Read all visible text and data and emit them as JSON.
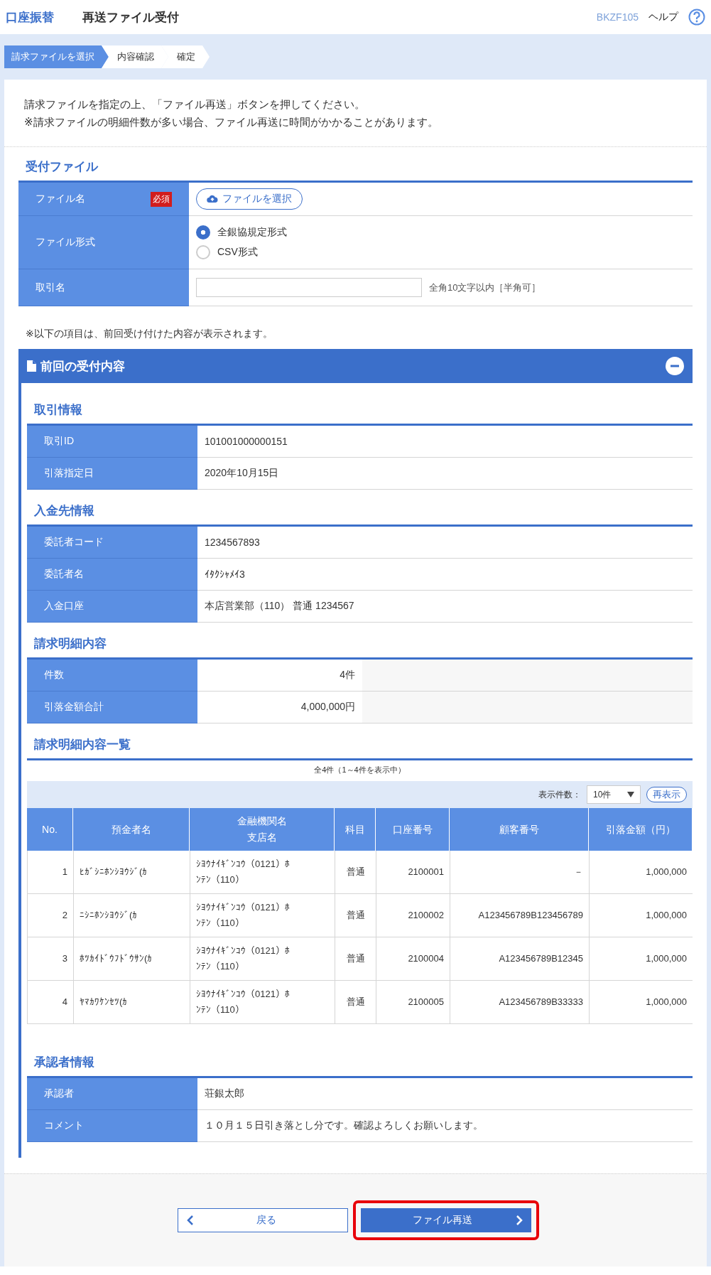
{
  "header": {
    "category": "口座振替",
    "title": "再送ファイル受付",
    "screen_id": "BKZF105",
    "help": "ヘルプ"
  },
  "steps": [
    {
      "label": "請求ファイルを選択",
      "selected": true
    },
    {
      "label": "内容確認",
      "selected": false
    },
    {
      "label": "確定",
      "selected": false
    }
  ],
  "intro": [
    "請求ファイルを指定の上、「ファイル再送」ボタンを押してください。",
    "※請求ファイルの明細件数が多い場合、ファイル再送に時間がかかることがあります。"
  ],
  "upload": {
    "heading": "受付ファイル",
    "rows": [
      {
        "kind": "file",
        "label": "ファイル名",
        "required": "必須",
        "button": "ファイルを選択"
      },
      {
        "kind": "radio",
        "label": "ファイル形式",
        "options": [
          {
            "label": "全銀協規定形式",
            "selected": true
          },
          {
            "label": "CSV形式",
            "selected": false
          }
        ]
      },
      {
        "kind": "text",
        "label": "取引名",
        "hint": "全角10文字以内［半角可］"
      }
    ]
  },
  "note": "※以下の項目は、前回受け付けた内容が表示されます。",
  "previous": {
    "title": "前回の受付内容",
    "expanded": true,
    "sections": [
      {
        "heading": "取引情報",
        "rows": [
          {
            "label": "取引ID",
            "value": "101001000000151"
          },
          {
            "label": "引落指定日",
            "value": "2020年10月15日"
          }
        ]
      },
      {
        "heading": "入金先情報",
        "rows": [
          {
            "label": "委託者コード",
            "value": "1234567893"
          },
          {
            "label": "委託者名",
            "value": "ｲﾀｸｼｬﾒｲ3"
          },
          {
            "label": "入金口座",
            "value": "本店営業部（110） 普通 1234567"
          }
        ]
      },
      {
        "heading": "請求明細内容",
        "narrow": true,
        "rows": [
          {
            "label": "件数",
            "value": "4件"
          },
          {
            "label": "引落金額合計",
            "value": "4,000,000円"
          }
        ]
      }
    ],
    "list": {
      "heading": "請求明細内容一覧",
      "summary": "全4件（1～4件を表示中）",
      "page_size_label": "表示件数：",
      "page_size": "10件",
      "refresh": "再表示",
      "columns": [
        "No.",
        "預金者名",
        "金融機関名支店名",
        "科目",
        "口座番号",
        "顧客番号",
        "引落金額（円）"
      ],
      "rows": [
        [
          "1",
          "ﾋｶﾞｼﾆﾎﾝｼﾖｳｼﾞ(ｶ",
          "ｼﾖｳﾅｲｷﾞﾝｺｳ（0121）ﾎﾝﾃﾝ（110）",
          "普通",
          "2100001",
          "－",
          "1,000,000"
        ],
        [
          "2",
          "ﾆｼﾆﾎﾝｼﾖｳｼﾞ(ｶ",
          "ｼﾖｳﾅｲｷﾞﾝｺｳ（0121）ﾎﾝﾃﾝ（110）",
          "普通",
          "2100002",
          "A123456789B123456789",
          "1,000,000"
        ],
        [
          "3",
          "ﾎﾂｶｲﾄﾞｳﾌﾄﾞｳｻﾝ(ｶ",
          "ｼﾖｳﾅｲｷﾞﾝｺｳ（0121）ﾎﾝﾃﾝ（110）",
          "普通",
          "2100004",
          "A123456789B12345",
          "1,000,000"
        ],
        [
          "4",
          "ﾔﾏｶﾜｹﾝｾﾂ(ｶ",
          "ｼﾖｳﾅｲｷﾞﾝｺｳ（0121）ﾎﾝﾃﾝ（110）",
          "普通",
          "2100005",
          "A123456789B33333",
          "1,000,000"
        ]
      ]
    },
    "approver": {
      "heading": "承認者情報",
      "rows": [
        {
          "label": "承認者",
          "value": "荘銀太郎"
        },
        {
          "label": "コメント",
          "value": "１０月１５日引き落とし分です。確認よろしくお願いします。"
        }
      ]
    }
  },
  "buttons": [
    {
      "kind": "back",
      "label": "戻る",
      "highlighted": false
    },
    {
      "kind": "next",
      "label": "ファイル再送",
      "highlighted": true
    }
  ]
}
